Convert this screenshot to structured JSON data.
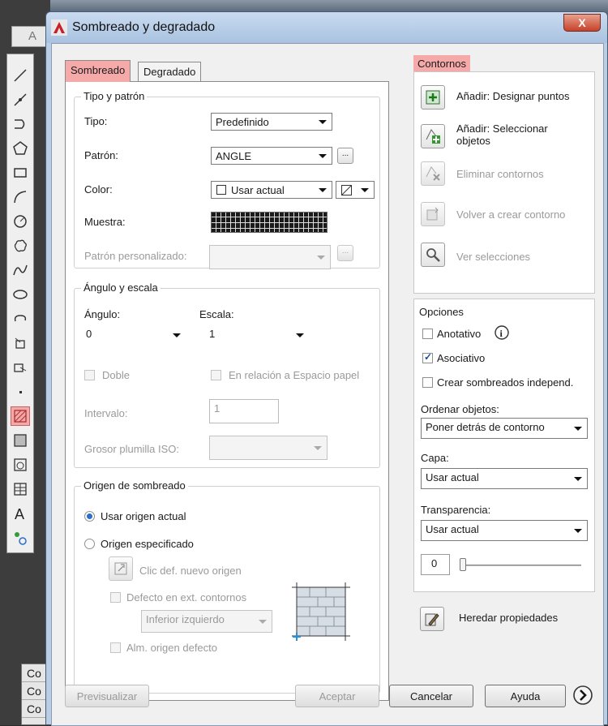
{
  "background": {
    "input_text": "A",
    "bottom_items": [
      "Co",
      "Co",
      "Co"
    ]
  },
  "dialog": {
    "title": "Sombreado y degradado",
    "close_label": "X"
  },
  "tabs": [
    {
      "label": "Sombreado",
      "active": true
    },
    {
      "label": "Degradado",
      "active": false
    }
  ],
  "pattern": {
    "group_title": "Tipo y patrón",
    "type_label": "Tipo:",
    "type_value": "Predefinido",
    "pattern_label": "Patrón:",
    "pattern_value": "ANGLE",
    "browse_label": "...",
    "color_label": "Color:",
    "color_value": "Usar actual",
    "sample_label": "Muestra:",
    "custom_label": "Patrón personalizado:",
    "custom_browse": "..."
  },
  "angle_scale": {
    "group_title": "Ángulo y escala",
    "angle_label": "Ángulo:",
    "angle_value": "0",
    "scale_label": "Escala:",
    "scale_value": "1",
    "double_label": "Doble",
    "paper_label": "En relación a Espacio papel",
    "interval_label": "Intervalo:",
    "interval_value": "1",
    "iso_label": "Grosor plumilla ISO:"
  },
  "origin": {
    "group_title": "Origen de sombreado",
    "current_label": "Usar origen actual",
    "specified_label": "Origen especificado",
    "click_label": "Clic def. nuevo origen",
    "default_ext_label": "Defecto en ext. contornos",
    "position_value": "Inferior izquierdo",
    "store_label": "Alm. origen defecto"
  },
  "boundaries": {
    "title": "Contornos",
    "add_points": "Añadir: Designar puntos",
    "add_objects": "Añadir: Seleccionar objetos",
    "remove": "Eliminar contornos",
    "recreate": "Volver a crear contorno",
    "view": "Ver selecciones"
  },
  "options": {
    "title": "Opciones",
    "annotative": "Anotativo",
    "annotative_checked": false,
    "associative": "Asociativo",
    "associative_checked": true,
    "independent": "Crear sombreados independ.",
    "independent_checked": false,
    "draw_order_label": "Ordenar objetos:",
    "draw_order_value": "Poner detrás de contorno",
    "layer_label": "Capa:",
    "layer_value": "Usar actual",
    "transparency_label": "Transparencia:",
    "transparency_value": "Usar actual",
    "transparency_amount": "0"
  },
  "inherit_label": "Heredar propiedades",
  "footer": {
    "preview": "Previsualizar",
    "ok": "Aceptar",
    "cancel": "Cancelar",
    "help": "Ayuda"
  }
}
